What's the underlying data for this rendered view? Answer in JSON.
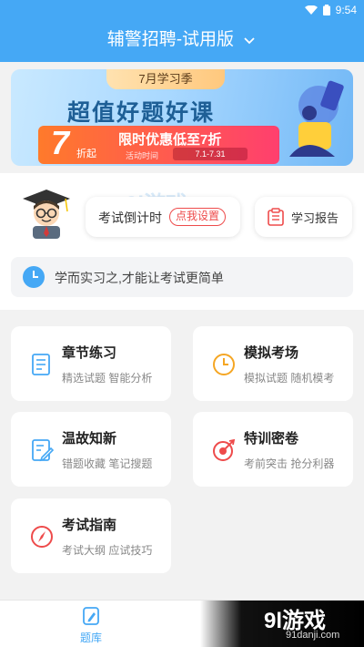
{
  "status_bar": {
    "time": "9:54"
  },
  "header": {
    "title": "辅警招聘-试用版"
  },
  "banner": {
    "ribbon": "7月学习季",
    "headline": "超值好题好课",
    "discount_number": "7",
    "discount_suffix": "折起",
    "promo_text": "限时优惠低至7折",
    "activity_time_label": "活动时间",
    "activity_dates": "7.1-7.31"
  },
  "countdown": {
    "label": "考试倒计时",
    "set_button": "点我设置"
  },
  "report": {
    "label": "学习报告"
  },
  "motto": "学而实习之,才能让考试更简单",
  "features": [
    {
      "title": "章节练习",
      "subtitle": "精选试题 智能分析",
      "icon": "document-edit-icon"
    },
    {
      "title": "模拟考场",
      "subtitle": "模拟试题 随机模考",
      "icon": "clock-icon"
    },
    {
      "title": "温故知新",
      "subtitle": "错题收藏 笔记搜题",
      "icon": "review-note-icon"
    },
    {
      "title": "特训密卷",
      "subtitle": "考前突击 抢分利器",
      "icon": "target-icon"
    },
    {
      "title": "考试指南",
      "subtitle": "考试大纲 应试技巧",
      "icon": "compass-icon"
    }
  ],
  "bottom_nav": {
    "active_label": "题库"
  },
  "watermark": {
    "main": "9l游戏",
    "sub": "91danji.com",
    "bg": "9l游戏"
  },
  "colors": {
    "primary": "#45a8f5",
    "accent_red": "#ee4b4b",
    "orange": "#f5a623"
  }
}
